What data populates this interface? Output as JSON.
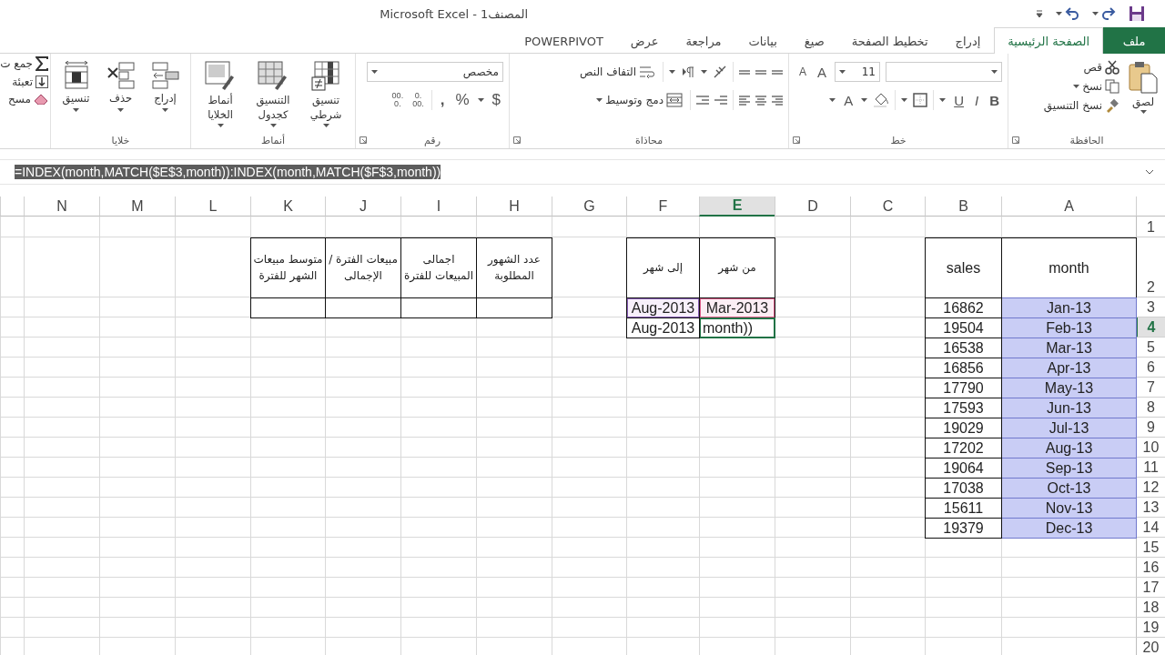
{
  "title_bar": {
    "title": "Microsoft Excel - المصنف1"
  },
  "tabs": [
    {
      "label": "ملف",
      "kind": "file",
      "selected": false
    },
    {
      "label": "الصفحة الرئيسية",
      "kind": "tab",
      "selected": true
    },
    {
      "label": "إدراج",
      "kind": "tab",
      "selected": false
    },
    {
      "label": "تخطيط الصفحة",
      "kind": "tab",
      "selected": false
    },
    {
      "label": "صيغ",
      "kind": "tab",
      "selected": false
    },
    {
      "label": "بيانات",
      "kind": "tab",
      "selected": false
    },
    {
      "label": "مراجعة",
      "kind": "tab",
      "selected": false
    },
    {
      "label": "عرض",
      "kind": "tab",
      "selected": false
    },
    {
      "label": "POWERPIVOT",
      "kind": "tab",
      "selected": false
    }
  ],
  "ribbon": {
    "groups": [
      {
        "kind": "clipboard",
        "label": "الحافظة",
        "buttons": [
          "لصق",
          "قص",
          "نسخ",
          "نسخ التنسيق"
        ]
      },
      {
        "kind": "font",
        "label": "خط",
        "font_size": "11",
        "letters": [
          "A",
          "A",
          "B",
          "I",
          "U",
          "A"
        ]
      },
      {
        "kind": "alignment",
        "label": "محاذاة",
        "buttons": [
          "التفاف النص",
          "دمج وتوسيط"
        ]
      },
      {
        "kind": "number",
        "label": "رقم",
        "format": "مخصص",
        "symbols": [
          "$",
          "%",
          ","
        ],
        "decimals": [
          ".0",
          ".00",
          ".00",
          ".0"
        ]
      },
      {
        "kind": "styles",
        "label": "أنماط",
        "buttons": [
          "تنسيق شرطي",
          "التنسيق كجدول",
          "أنماط الخلايا"
        ]
      },
      {
        "kind": "cells",
        "label": "خلايا",
        "buttons": [
          "إدراج",
          "حذف",
          "تنسيق"
        ]
      },
      {
        "kind": "editing",
        "buttons": [
          "جمع ت",
          "تعبئة",
          "مسح"
        ]
      }
    ]
  },
  "formula_bar": {
    "formula": "=INDEX(month,MATCH($E$3,month)):INDEX(month,MATCH($F$3,month))",
    "selected": true
  },
  "sheet": {
    "column_headers": [
      {
        "label": "A",
        "selected": false
      },
      {
        "label": "B",
        "selected": false
      },
      {
        "label": "C",
        "selected": false
      },
      {
        "label": "D",
        "selected": false
      },
      {
        "label": "E",
        "selected": true
      },
      {
        "label": "F",
        "selected": false
      },
      {
        "label": "G",
        "selected": false
      },
      {
        "label": "H",
        "selected": false
      },
      {
        "label": "I",
        "selected": false
      },
      {
        "label": "J",
        "selected": false
      },
      {
        "label": "K",
        "selected": false
      },
      {
        "label": "L",
        "selected": false
      },
      {
        "label": "M",
        "selected": false
      },
      {
        "label": "N",
        "selected": false
      }
    ],
    "row_headers": [
      {
        "label": "1",
        "selected": false
      },
      {
        "label": "2",
        "selected": false
      },
      {
        "label": "3",
        "selected": false
      },
      {
        "label": "4",
        "selected": true
      },
      {
        "label": "5",
        "selected": false
      },
      {
        "label": "6",
        "selected": false
      },
      {
        "label": "7",
        "selected": false
      },
      {
        "label": "8",
        "selected": false
      },
      {
        "label": "9",
        "selected": false
      },
      {
        "label": "10",
        "selected": false
      },
      {
        "label": "11",
        "selected": false
      },
      {
        "label": "12",
        "selected": false
      },
      {
        "label": "13",
        "selected": false
      },
      {
        "label": "14",
        "selected": false
      },
      {
        "label": "15",
        "selected": false
      },
      {
        "label": "16",
        "selected": false
      },
      {
        "label": "17",
        "selected": false
      },
      {
        "label": "18",
        "selected": false
      },
      {
        "label": "19",
        "selected": false
      },
      {
        "label": "20",
        "selected": false
      }
    ],
    "sales_table": {
      "headers": [
        "month",
        "sales"
      ],
      "month_highlighted": true,
      "rows": [
        {
          "month": "Jan-13",
          "sales": "16862"
        },
        {
          "month": "Feb-13",
          "sales": "19504"
        },
        {
          "month": "Mar-13",
          "sales": "16538"
        },
        {
          "month": "Apr-13",
          "sales": "16856"
        },
        {
          "month": "May-13",
          "sales": "17790"
        },
        {
          "month": "Jun-13",
          "sales": "17593"
        },
        {
          "month": "Jul-13",
          "sales": "19029"
        },
        {
          "month": "Aug-13",
          "sales": "17202"
        },
        {
          "month": "Sep-13",
          "sales": "19064"
        },
        {
          "month": "Oct-13",
          "sales": "17038"
        },
        {
          "month": "Nov-13",
          "sales": "15611"
        },
        {
          "month": "Dec-13",
          "sales": "19379"
        }
      ]
    },
    "period_table": {
      "headers": [
        "من شهر",
        "إلى شهر"
      ],
      "rows": [
        {
          "from": "Mar-2013",
          "to": "Aug-2013",
          "active": false
        },
        {
          "from": "month))",
          "to": "Aug-2013",
          "active": true
        }
      ]
    },
    "summary_table": {
      "headers": [
        "عدد الشهور المطلوبة",
        "اجمالى المبيعات للفترة",
        "مبيعات الفترة / الإجمالى",
        "متوسط مبيعات الشهر للفترة"
      ]
    }
  }
}
